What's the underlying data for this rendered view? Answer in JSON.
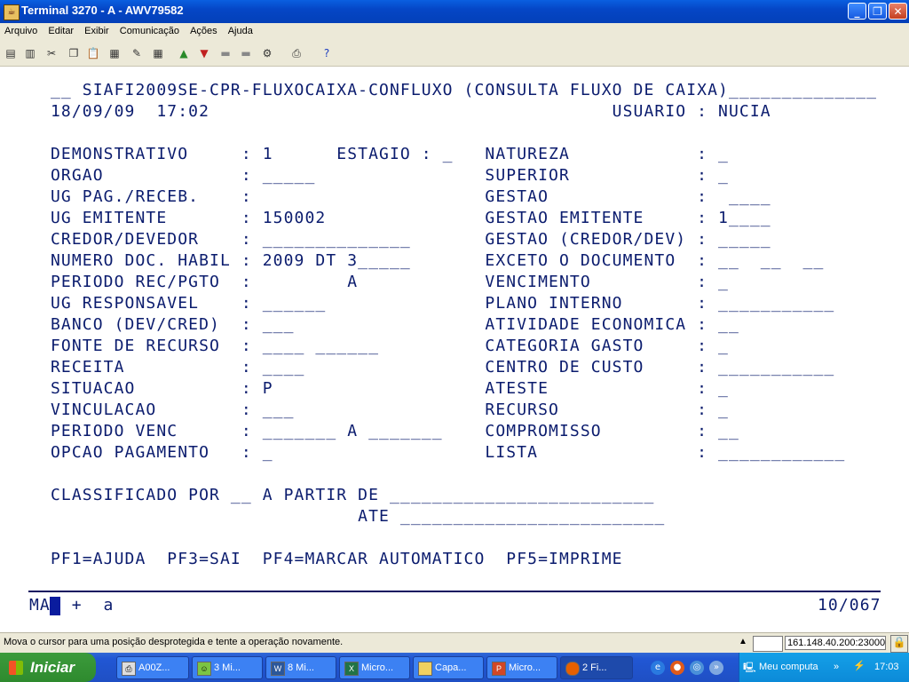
{
  "window": {
    "title": "Terminal 3270 - A - AWV79582",
    "app_icon": "java-terminal-icon"
  },
  "menu": [
    "Arquivo",
    "Editar",
    "Exibir",
    "Comunicação",
    "Ações",
    "Ajuda"
  ],
  "toolbar_icons": [
    "copy-screen-icon",
    "print-screen-icon",
    "cut-icon",
    "copy-icon",
    "paste-icon",
    "paste-special-icon",
    "macro-icon",
    "keypad-icon",
    "send-file-icon",
    "receive-file-icon",
    "transfer-icon",
    "disconnect-icon",
    "settings-icon",
    "print-icon",
    "help-icon"
  ],
  "terminal": {
    "lines": [
      "__ SIAFI2009SE-CPR-FLUXOCAIXA-CONFLUXO (CONSULTA FLUXO DE CAIXA)______________",
      "18/09/09  17:02                                      USUARIO : NUCIA",
      "DEMONSTRATIVO     : 1      ESTAGIO : _   NATUREZA            : _",
      "ORGAO             : _____                SUPERIOR            : _",
      "UG PAG./RECEB.    :                      GESTAO              :  ____",
      "UG EMITENTE       : 150002               GESTAO EMITENTE     : 1____",
      "CREDOR/DEVEDOR    : ______________       GESTAO (CREDOR/DEV) : _____",
      "NUMERO DOC. HABIL : 2009 DT 3_____       EXCETO O DOCUMENTO  : __  __  __",
      "PERIODO REC/PGTO  :         A            VENCIMENTO          : _",
      "UG RESPONSAVEL    : ______               PLANO INTERNO       : ___________",
      "BANCO (DEV/CRED)  : ___                  ATIVIDADE ECONOMICA : __",
      "FONTE DE RECURSO  : ____ ______          CATEGORIA GASTO     : _",
      "RECEITA           : ____                 CENTRO DE CUSTO     : ___________",
      "SITUACAO          : P                    ATESTE              : _",
      "VINCULACAO        : ___                  RECURSO             : _",
      "PERIODO VENC      : _______ A _______    COMPROMISSO         : __",
      "OPCAO PAGAMENTO   : _                    LISTA               : ____________",
      "",
      "CLASSIFICADO POR __ A PARTIR DE _________________________",
      "                             ATE _________________________",
      "",
      "PF1=AJUDA  PF3=SAI  PF4=MARCAR AUTOMATICO  PF5=IMPRIME"
    ],
    "oia_left": "MA  +  a",
    "oia_right": "10/067"
  },
  "status": {
    "message": "Mova o cursor para uma posição desprotegida e tente a operação novamente.",
    "host": "161.148.40.200:23000"
  },
  "taskbar": {
    "start_label": "Iniciar",
    "tasks": [
      {
        "label": "A00Z...",
        "icon": "printer-icon"
      },
      {
        "label": "3 Mi...",
        "icon": "chat-icon"
      },
      {
        "label": "8 Mi...",
        "icon": "word-icon"
      },
      {
        "label": "Micro...",
        "icon": "excel-icon"
      },
      {
        "label": "Capa...",
        "icon": "folder-icon"
      },
      {
        "label": "Micro...",
        "icon": "powerpoint-icon"
      },
      {
        "label": "2 Fi...",
        "icon": "firefox-icon"
      }
    ],
    "desktop_label": "Meu computa",
    "clock": "17:03"
  }
}
